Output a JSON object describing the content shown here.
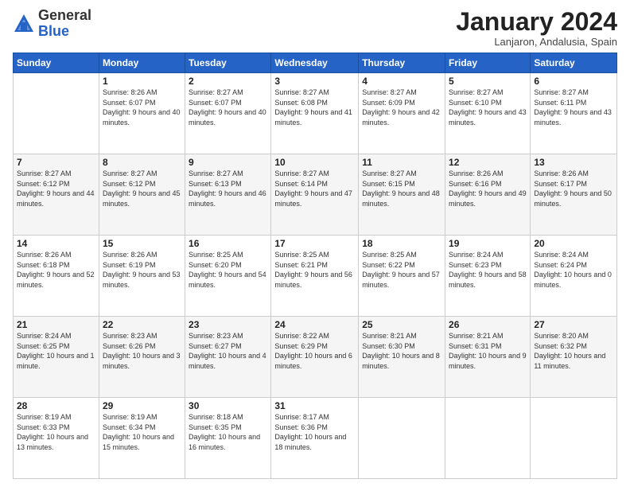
{
  "header": {
    "logo_general": "General",
    "logo_blue": "Blue",
    "month_title": "January 2024",
    "location": "Lanjaron, Andalusia, Spain"
  },
  "columns": [
    "Sunday",
    "Monday",
    "Tuesday",
    "Wednesday",
    "Thursday",
    "Friday",
    "Saturday"
  ],
  "weeks": [
    [
      {
        "day": "",
        "sunrise": "",
        "sunset": "",
        "daylight": ""
      },
      {
        "day": "1",
        "sunrise": "Sunrise: 8:26 AM",
        "sunset": "Sunset: 6:07 PM",
        "daylight": "Daylight: 9 hours and 40 minutes."
      },
      {
        "day": "2",
        "sunrise": "Sunrise: 8:27 AM",
        "sunset": "Sunset: 6:07 PM",
        "daylight": "Daylight: 9 hours and 40 minutes."
      },
      {
        "day": "3",
        "sunrise": "Sunrise: 8:27 AM",
        "sunset": "Sunset: 6:08 PM",
        "daylight": "Daylight: 9 hours and 41 minutes."
      },
      {
        "day": "4",
        "sunrise": "Sunrise: 8:27 AM",
        "sunset": "Sunset: 6:09 PM",
        "daylight": "Daylight: 9 hours and 42 minutes."
      },
      {
        "day": "5",
        "sunrise": "Sunrise: 8:27 AM",
        "sunset": "Sunset: 6:10 PM",
        "daylight": "Daylight: 9 hours and 43 minutes."
      },
      {
        "day": "6",
        "sunrise": "Sunrise: 8:27 AM",
        "sunset": "Sunset: 6:11 PM",
        "daylight": "Daylight: 9 hours and 43 minutes."
      }
    ],
    [
      {
        "day": "7",
        "sunrise": "Sunrise: 8:27 AM",
        "sunset": "Sunset: 6:12 PM",
        "daylight": "Daylight: 9 hours and 44 minutes."
      },
      {
        "day": "8",
        "sunrise": "Sunrise: 8:27 AM",
        "sunset": "Sunset: 6:12 PM",
        "daylight": "Daylight: 9 hours and 45 minutes."
      },
      {
        "day": "9",
        "sunrise": "Sunrise: 8:27 AM",
        "sunset": "Sunset: 6:13 PM",
        "daylight": "Daylight: 9 hours and 46 minutes."
      },
      {
        "day": "10",
        "sunrise": "Sunrise: 8:27 AM",
        "sunset": "Sunset: 6:14 PM",
        "daylight": "Daylight: 9 hours and 47 minutes."
      },
      {
        "day": "11",
        "sunrise": "Sunrise: 8:27 AM",
        "sunset": "Sunset: 6:15 PM",
        "daylight": "Daylight: 9 hours and 48 minutes."
      },
      {
        "day": "12",
        "sunrise": "Sunrise: 8:26 AM",
        "sunset": "Sunset: 6:16 PM",
        "daylight": "Daylight: 9 hours and 49 minutes."
      },
      {
        "day": "13",
        "sunrise": "Sunrise: 8:26 AM",
        "sunset": "Sunset: 6:17 PM",
        "daylight": "Daylight: 9 hours and 50 minutes."
      }
    ],
    [
      {
        "day": "14",
        "sunrise": "Sunrise: 8:26 AM",
        "sunset": "Sunset: 6:18 PM",
        "daylight": "Daylight: 9 hours and 52 minutes."
      },
      {
        "day": "15",
        "sunrise": "Sunrise: 8:26 AM",
        "sunset": "Sunset: 6:19 PM",
        "daylight": "Daylight: 9 hours and 53 minutes."
      },
      {
        "day": "16",
        "sunrise": "Sunrise: 8:25 AM",
        "sunset": "Sunset: 6:20 PM",
        "daylight": "Daylight: 9 hours and 54 minutes."
      },
      {
        "day": "17",
        "sunrise": "Sunrise: 8:25 AM",
        "sunset": "Sunset: 6:21 PM",
        "daylight": "Daylight: 9 hours and 56 minutes."
      },
      {
        "day": "18",
        "sunrise": "Sunrise: 8:25 AM",
        "sunset": "Sunset: 6:22 PM",
        "daylight": "Daylight: 9 hours and 57 minutes."
      },
      {
        "day": "19",
        "sunrise": "Sunrise: 8:24 AM",
        "sunset": "Sunset: 6:23 PM",
        "daylight": "Daylight: 9 hours and 58 minutes."
      },
      {
        "day": "20",
        "sunrise": "Sunrise: 8:24 AM",
        "sunset": "Sunset: 6:24 PM",
        "daylight": "Daylight: 10 hours and 0 minutes."
      }
    ],
    [
      {
        "day": "21",
        "sunrise": "Sunrise: 8:24 AM",
        "sunset": "Sunset: 6:25 PM",
        "daylight": "Daylight: 10 hours and 1 minute."
      },
      {
        "day": "22",
        "sunrise": "Sunrise: 8:23 AM",
        "sunset": "Sunset: 6:26 PM",
        "daylight": "Daylight: 10 hours and 3 minutes."
      },
      {
        "day": "23",
        "sunrise": "Sunrise: 8:23 AM",
        "sunset": "Sunset: 6:27 PM",
        "daylight": "Daylight: 10 hours and 4 minutes."
      },
      {
        "day": "24",
        "sunrise": "Sunrise: 8:22 AM",
        "sunset": "Sunset: 6:29 PM",
        "daylight": "Daylight: 10 hours and 6 minutes."
      },
      {
        "day": "25",
        "sunrise": "Sunrise: 8:21 AM",
        "sunset": "Sunset: 6:30 PM",
        "daylight": "Daylight: 10 hours and 8 minutes."
      },
      {
        "day": "26",
        "sunrise": "Sunrise: 8:21 AM",
        "sunset": "Sunset: 6:31 PM",
        "daylight": "Daylight: 10 hours and 9 minutes."
      },
      {
        "day": "27",
        "sunrise": "Sunrise: 8:20 AM",
        "sunset": "Sunset: 6:32 PM",
        "daylight": "Daylight: 10 hours and 11 minutes."
      }
    ],
    [
      {
        "day": "28",
        "sunrise": "Sunrise: 8:19 AM",
        "sunset": "Sunset: 6:33 PM",
        "daylight": "Daylight: 10 hours and 13 minutes."
      },
      {
        "day": "29",
        "sunrise": "Sunrise: 8:19 AM",
        "sunset": "Sunset: 6:34 PM",
        "daylight": "Daylight: 10 hours and 15 minutes."
      },
      {
        "day": "30",
        "sunrise": "Sunrise: 8:18 AM",
        "sunset": "Sunset: 6:35 PM",
        "daylight": "Daylight: 10 hours and 16 minutes."
      },
      {
        "day": "31",
        "sunrise": "Sunrise: 8:17 AM",
        "sunset": "Sunset: 6:36 PM",
        "daylight": "Daylight: 10 hours and 18 minutes."
      },
      {
        "day": "",
        "sunrise": "",
        "sunset": "",
        "daylight": ""
      },
      {
        "day": "",
        "sunrise": "",
        "sunset": "",
        "daylight": ""
      },
      {
        "day": "",
        "sunrise": "",
        "sunset": "",
        "daylight": ""
      }
    ]
  ]
}
